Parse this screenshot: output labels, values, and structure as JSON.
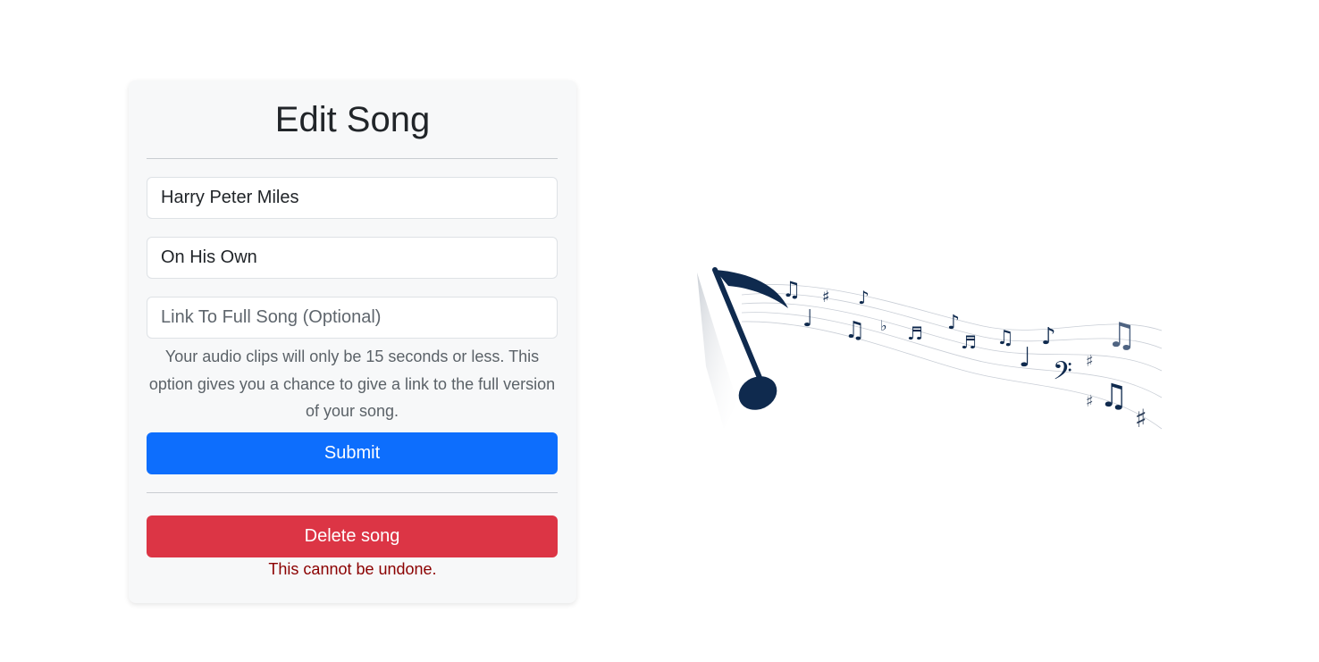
{
  "form": {
    "title": "Edit Song",
    "artist_value": "Harry Peter Miles",
    "song_value": "On His Own",
    "link_placeholder": "Link To Full Song (Optional)",
    "help_text": "Your audio clips will only be 15 seconds or less. This option gives you a chance to give a link to the full version of your song.",
    "submit_label": "Submit",
    "delete_label": "Delete song",
    "warning_text": "This cannot be undone."
  },
  "colors": {
    "submit": "#0d6efd",
    "delete": "#dc3545",
    "warning": "#8b0000",
    "notes": "#0f2a4e"
  },
  "illustration": {
    "icon": "music-notes-illustration"
  }
}
